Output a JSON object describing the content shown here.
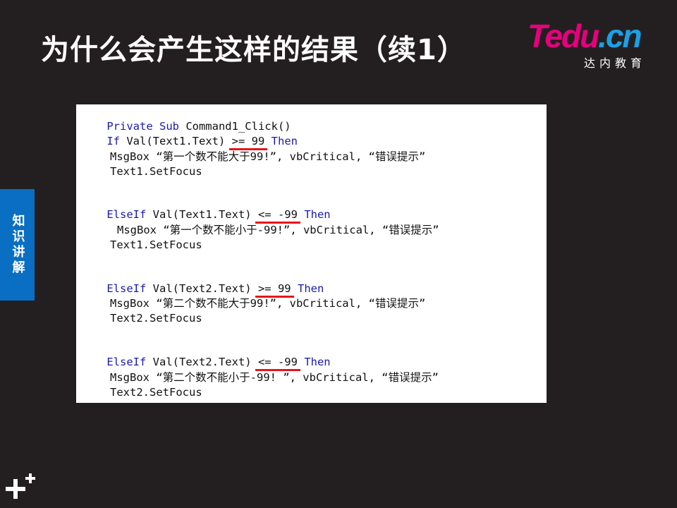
{
  "slide": {
    "title": "为什么会产生这样的结果（续1）",
    "side_tab": "知识讲解"
  },
  "logo": {
    "word_a": "Tedu",
    "word_b": ".cn",
    "subtitle": "达内教育",
    "colors": {
      "pink": "#e6007e",
      "blue": "#1e9fe3"
    }
  },
  "code": {
    "lines": [
      {
        "kw1": "Private Sub",
        "text": " Command1_Click()"
      },
      {
        "kw1": "If",
        "pre": " Val(Text1.Text) ",
        "cond": ">= 99",
        "kw2": "Then"
      },
      {
        "msgbox": "MsgBox “第一个数不能大于99!”, vbCritical, “错误提示”"
      },
      {
        "text": "Text1.SetFocus"
      },
      {
        "kw1": "ElseIf",
        "pre": " Val(Text1.Text) ",
        "cond": "<= -99",
        "kw2": "Then"
      },
      {
        "msgbox": "MsgBox “第一个数不能小于-99!”, vbCritical, “错误提示”"
      },
      {
        "text": "Text1.SetFocus"
      },
      {
        "kw1": "ElseIf",
        "pre": " Val(Text2.Text) ",
        "cond": ">= 99",
        "kw2": "Then"
      },
      {
        "msgbox": "MsgBox “第二个数不能大于99!”, vbCritical, “错误提示”"
      },
      {
        "text": "Text2.SetFocus"
      },
      {
        "kw1": "ElseIf",
        "pre": " Val(Text2.Text) ",
        "cond": "<= -99",
        "kw2": "Then"
      },
      {
        "msgbox": "MsgBox “第二个数不能小于-99! ”, vbCritical, “错误提示”"
      },
      {
        "text": "Text2.SetFocus"
      }
    ]
  },
  "colors": {
    "background": "#231f20",
    "side_tab": "#0a6fc2",
    "keyword": "#1a1ab0",
    "underline": "#e8141b"
  },
  "icons": {
    "corner": "plus-plus-icon"
  }
}
